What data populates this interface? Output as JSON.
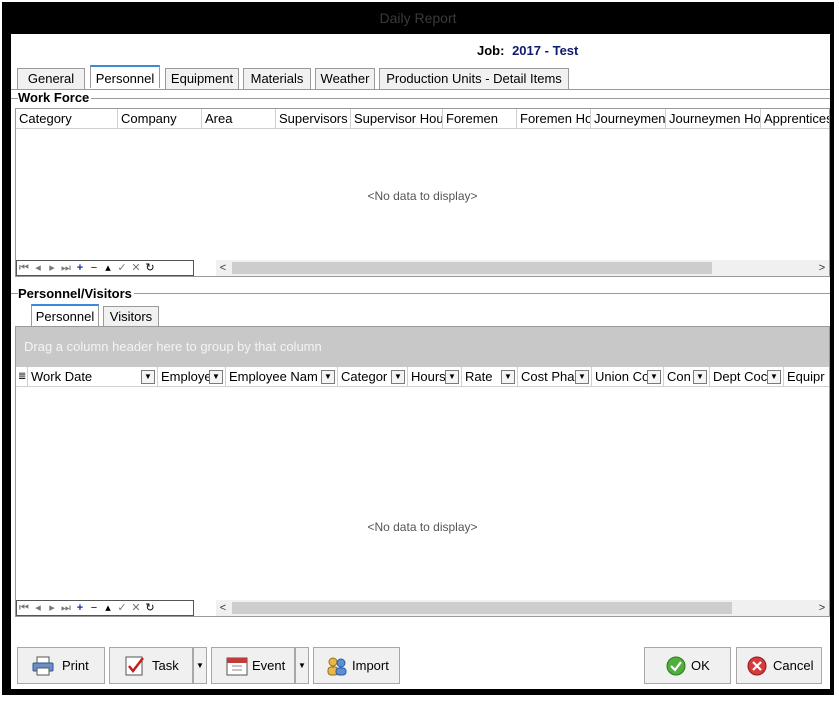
{
  "window": {
    "title": "Daily Report"
  },
  "job": {
    "label": "Job:",
    "number": "2017",
    "separator": "-",
    "name": "Test"
  },
  "tabs": [
    {
      "label": "General"
    },
    {
      "label": "Personnel",
      "active": true
    },
    {
      "label": "Equipment"
    },
    {
      "label": "Materials"
    },
    {
      "label": "Weather"
    },
    {
      "label": "Production Units - Detail Items"
    }
  ],
  "work_force": {
    "title": "Work Force",
    "columns": [
      "Category",
      "Company",
      "Area",
      "Supervisors",
      "Supervisor Hou",
      "Foremen",
      "Foremen Ho",
      "Journeymen",
      "Journeymen Ho",
      "Apprentices"
    ],
    "empty_text": "<No data to display>"
  },
  "personnel_visitors": {
    "title": "Personnel/Visitors",
    "tabs": [
      {
        "label": "Personnel",
        "active": true
      },
      {
        "label": "Visitors"
      }
    ],
    "group_by_hint": "Drag a column header here to group by that column",
    "columns": [
      "Work Date",
      "Employe",
      "Employee Nam",
      "Categor",
      "Hours",
      "Rate",
      "Cost Pha",
      "Union Co",
      "Con",
      "Dept Coc",
      "Equipr"
    ],
    "empty_text": "<No data to display>"
  },
  "buttons": {
    "print": "Print",
    "task": "Task",
    "event": "Event",
    "import": "Import",
    "ok": "OK",
    "cancel": "Cancel"
  },
  "colors": {
    "accent_tab": "#3b8ad6",
    "job_value": "#101a6e",
    "groupby_panel": "#c8c8c8",
    "window_frame": "#000000"
  }
}
